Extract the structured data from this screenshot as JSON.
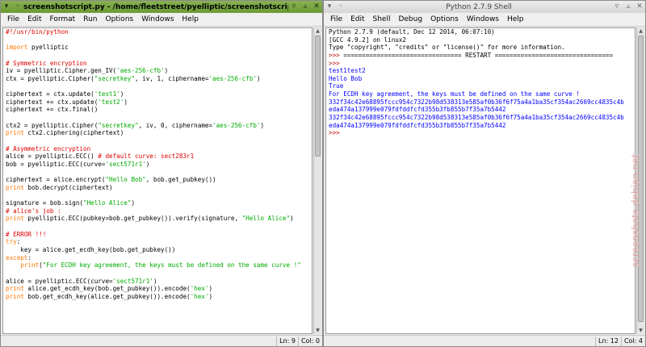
{
  "editor_window": {
    "title": "screenshotscript.py - /home/fleetstreet/pyelliptic/screenshotscript.py (2.7.9)",
    "menu": [
      "File",
      "Edit",
      "Format",
      "Run",
      "Options",
      "Windows",
      "Help"
    ],
    "status": {
      "line": "Ln: 9",
      "col": "Col: 0"
    },
    "code": [
      [
        [
          "cmt",
          "#!/usr/bin/python"
        ]
      ],
      [
        [
          "def",
          ""
        ]
      ],
      [
        [
          "key",
          "import"
        ],
        [
          "def",
          " pyelliptic"
        ]
      ],
      [
        [
          "def",
          ""
        ]
      ],
      [
        [
          "cmt",
          "# Symmetric encryption"
        ]
      ],
      [
        [
          "def",
          "iv = pyelliptic.Cipher.gen_IV("
        ],
        [
          "str",
          "'aes-256-cfb'"
        ],
        [
          "def",
          ")"
        ]
      ],
      [
        [
          "def",
          "ctx = pyelliptic.Cipher("
        ],
        [
          "str",
          "\"secretkey\""
        ],
        [
          "def",
          ", iv, 1, ciphername="
        ],
        [
          "str",
          "'aes-256-cfb'"
        ],
        [
          "def",
          ")"
        ]
      ],
      [
        [
          "def",
          ""
        ]
      ],
      [
        [
          "def",
          "ciphertext = ctx.update("
        ],
        [
          "str",
          "'test1'"
        ],
        [
          "def",
          ")"
        ]
      ],
      [
        [
          "def",
          "ciphertext += ctx.update("
        ],
        [
          "str",
          "'test2'"
        ],
        [
          "def",
          ")"
        ]
      ],
      [
        [
          "def",
          "ciphertext += ctx.final()"
        ]
      ],
      [
        [
          "def",
          ""
        ]
      ],
      [
        [
          "def",
          "ctx2 = pyelliptic.Cipher("
        ],
        [
          "str",
          "\"secretkey\""
        ],
        [
          "def",
          ", iv, 0, ciphername="
        ],
        [
          "str",
          "'aes-256-cfb'"
        ],
        [
          "def",
          ")"
        ]
      ],
      [
        [
          "key",
          "print"
        ],
        [
          "def",
          " ctx2.ciphering(ciphertext)"
        ]
      ],
      [
        [
          "def",
          ""
        ]
      ],
      [
        [
          "cmt",
          "# Asymmetric encryption"
        ]
      ],
      [
        [
          "def",
          "alice = pyelliptic.ECC() "
        ],
        [
          "cmt",
          "# default curve: sect283r1"
        ]
      ],
      [
        [
          "def",
          "bob = pyelliptic.ECC(curve="
        ],
        [
          "str",
          "'sect571r1'"
        ],
        [
          "def",
          ")"
        ]
      ],
      [
        [
          "def",
          ""
        ]
      ],
      [
        [
          "def",
          "ciphertext = alice.encrypt("
        ],
        [
          "str",
          "\"Hello Bob\""
        ],
        [
          "def",
          ", bob.get_pubkey())"
        ]
      ],
      [
        [
          "key",
          "print"
        ],
        [
          "def",
          " bob.decrypt(ciphertext)"
        ]
      ],
      [
        [
          "def",
          ""
        ]
      ],
      [
        [
          "def",
          "signature = bob.sign("
        ],
        [
          "str",
          "\"Hello Alice\""
        ],
        [
          "def",
          ")"
        ]
      ],
      [
        [
          "cmt",
          "# alice's job :"
        ]
      ],
      [
        [
          "key",
          "print"
        ],
        [
          "def",
          " pyelliptic.ECC(pubkey=bob.get_pubkey()).verify(signature, "
        ],
        [
          "str",
          "\"Hello Alice\""
        ],
        [
          "def",
          ")"
        ]
      ],
      [
        [
          "def",
          ""
        ]
      ],
      [
        [
          "cmt",
          "# ERROR !!!"
        ]
      ],
      [
        [
          "key",
          "try"
        ],
        [
          "def",
          ":"
        ]
      ],
      [
        [
          "def",
          "    key = alice.get_ecdh_key(bob.get_pubkey())"
        ]
      ],
      [
        [
          "key",
          "except"
        ],
        [
          "def",
          ":"
        ]
      ],
      [
        [
          "def",
          "    "
        ],
        [
          "key",
          "print"
        ],
        [
          "def",
          "("
        ],
        [
          "str",
          "\"For ECDH key agreement, the keys must be defined on the same curve !\""
        ]
      ],
      [
        [
          "def",
          ""
        ]
      ],
      [
        [
          "def",
          "alice = pyelliptic.ECC(curve="
        ],
        [
          "str",
          "'sect571r1'"
        ],
        [
          "def",
          ")"
        ]
      ],
      [
        [
          "key",
          "print"
        ],
        [
          "def",
          " alice.get_ecdh_key(bob.get_pubkey()).encode("
        ],
        [
          "str",
          "'hex'"
        ],
        [
          "def",
          ")"
        ]
      ],
      [
        [
          "key",
          "print"
        ],
        [
          "def",
          " bob.get_ecdh_key(alice.get_pubkey()).encode("
        ],
        [
          "str",
          "'hex'"
        ],
        [
          "def",
          ")"
        ]
      ]
    ]
  },
  "shell_window": {
    "title": "Python 2.7.9 Shell",
    "menu": [
      "File",
      "Edit",
      "Shell",
      "Debug",
      "Options",
      "Windows",
      "Help"
    ],
    "status": {
      "line": "Ln: 12",
      "col": "Col: 4"
    },
    "lines": [
      [
        [
          "def",
          "Python 2.7.9 (default, Dec 12 2014, 06:07:10)"
        ]
      ],
      [
        [
          "def",
          "[GCC 4.9.2] on linux2"
        ]
      ],
      [
        [
          "def",
          "Type \"copyright\", \"credits\" or \"license()\" for more information."
        ]
      ],
      [
        [
          "prompt",
          ">>> "
        ],
        [
          "def",
          "================================ RESTART ================================"
        ]
      ],
      [
        [
          "prompt",
          ">>> "
        ]
      ],
      [
        [
          "out",
          "test1test2"
        ]
      ],
      [
        [
          "out",
          "Hello Bob"
        ]
      ],
      [
        [
          "out",
          "True"
        ]
      ],
      [
        [
          "out",
          "For ECDH key agreement, the keys must be defined on the same curve !"
        ]
      ],
      [
        [
          "out",
          "332f34c42e68895fccc954c7322b98d538313e585af0b36f6f75a4a1ba35cf354ac2669cc4835c4b"
        ]
      ],
      [
        [
          "out",
          "eda474a137999e079fdfddfcfd355b3fb855b7f35a7b5442"
        ]
      ],
      [
        [
          "out",
          "332f34c42e68895fccc954c7322b98d538313e585af0b36f6f75a4a1ba35cf354ac2669cc4835c4b"
        ]
      ],
      [
        [
          "out",
          "eda474a137999e079fdfddfcfd355b3fb855b7f35a7b5442"
        ]
      ],
      [
        [
          "prompt",
          ">>> "
        ]
      ]
    ]
  },
  "watermark": "screenshots.debian.net",
  "colors": {
    "keyword": "#ff7700",
    "builtin": "#900090",
    "string": "#00aa00",
    "comment": "#dd0000",
    "output": "#0000ff",
    "prompt": "#c00000"
  }
}
